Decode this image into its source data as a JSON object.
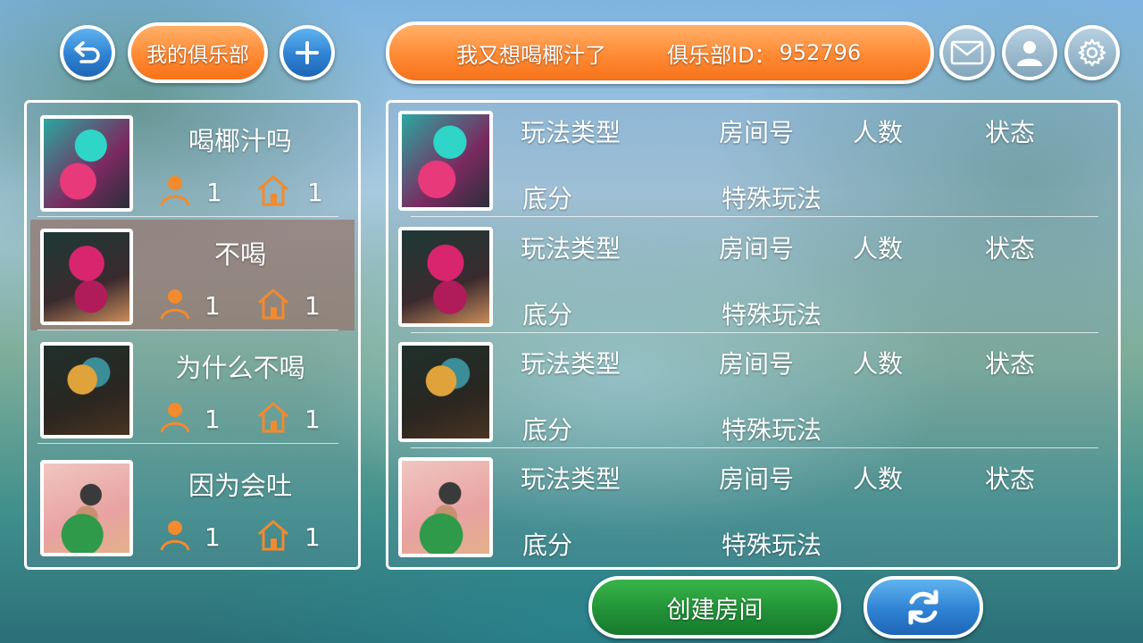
{
  "header": {
    "back_icon": "back-arrow-icon",
    "my_club_label": "我的俱乐部",
    "add_icon": "plus-icon",
    "club_name": "我又想喝椰汁了",
    "club_id_label": "俱乐部ID：",
    "club_id_value": "952796",
    "mail_icon": "mail-icon",
    "profile_icon": "profile-icon",
    "settings_icon": "gear-icon"
  },
  "clubs": [
    {
      "name": "喝椰汁吗",
      "members": "1",
      "rooms": "1",
      "selected": false
    },
    {
      "name": "不喝",
      "members": "1",
      "rooms": "1",
      "selected": true
    },
    {
      "name": "为什么不喝",
      "members": "1",
      "rooms": "1",
      "selected": false
    },
    {
      "name": "因为会吐",
      "members": "1",
      "rooms": "1",
      "selected": false
    }
  ],
  "room_labels": {
    "mode": "玩法类型",
    "room_no": "房间号",
    "players": "人数",
    "status": "状态",
    "base_score": "底分",
    "special_rules": "特殊玩法"
  },
  "footer": {
    "create_room_label": "创建房间",
    "refresh_icon": "refresh-icon"
  },
  "colors": {
    "accent_orange": "#ff8a34",
    "accent_blue": "#2f82d3",
    "accent_green": "#229238",
    "stat_icon_orange": "#f28a2e"
  }
}
